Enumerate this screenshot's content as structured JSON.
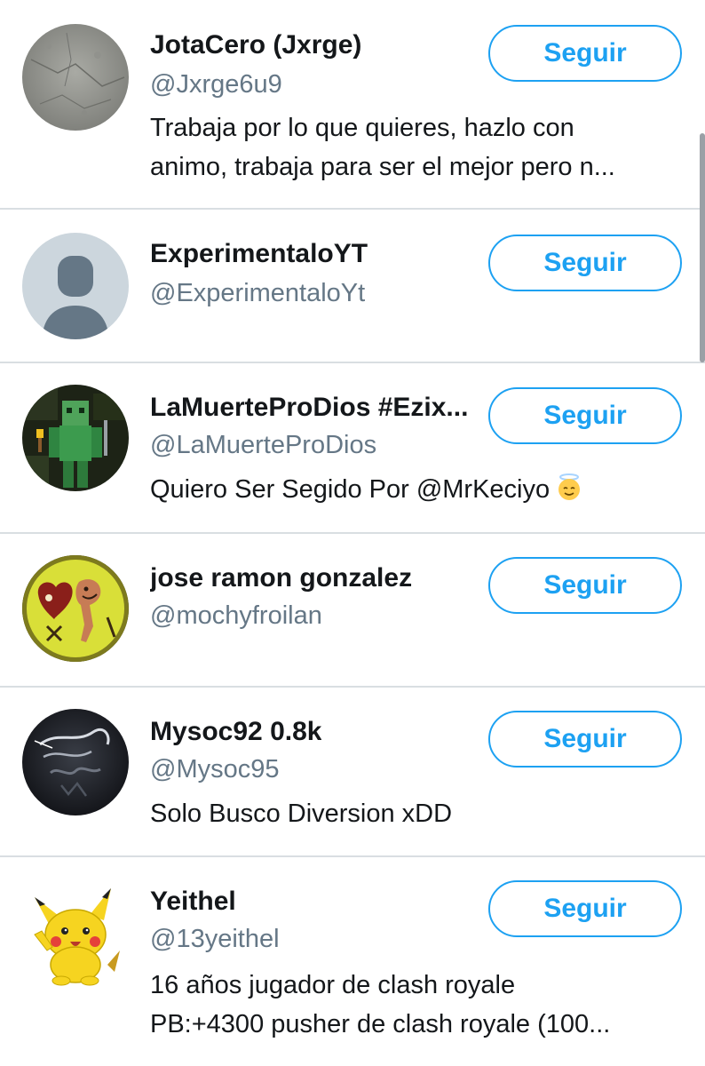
{
  "users": [
    {
      "name": "JotaCero (Jxrge)",
      "handle": "@Jxrge6u9",
      "bio_lines": [
        "Trabaja por lo que quieres, hazlo con",
        "animo, trabaja para ser el mejor pero n..."
      ],
      "button": "Seguir",
      "avatar": "stone-texture-avatar"
    },
    {
      "name": "ExperimentaloYT",
      "handle": "@ExperimentaloYt",
      "bio_lines": [],
      "button": "Seguir",
      "avatar": "default-profile-avatar"
    },
    {
      "name": "LaMuerteProDios #Ezix...",
      "handle": "@LaMuerteProDios",
      "bio_lines": [
        "Quiero Ser Segido Por @MrKeciyo"
      ],
      "bio_emoji": "angel-face-emoji",
      "button": "Seguir",
      "avatar": "minecraft-character-avatar"
    },
    {
      "name": "jose ramon gonzalez",
      "handle": "@mochyfroilan",
      "bio_lines": [],
      "button": "Seguir",
      "avatar": "cartoon-drawing-avatar"
    },
    {
      "name": "Mysoc92 0.8k",
      "handle": "@Mysoc95",
      "bio_lines": [
        "Solo Busco Diversion xDD"
      ],
      "button": "Seguir",
      "avatar": "dark-logo-avatar"
    },
    {
      "name": "Yeithel",
      "handle": "@13yeithel",
      "bio_lines": [
        "16 años jugador de clash royale",
        "PB:+4300 pusher de clash royale (100..."
      ],
      "button": "Seguir",
      "avatar": "pikachu-avatar"
    }
  ],
  "colors": {
    "accent": "#1da1f2",
    "handle": "#657786",
    "divider": "#d9dee2"
  }
}
